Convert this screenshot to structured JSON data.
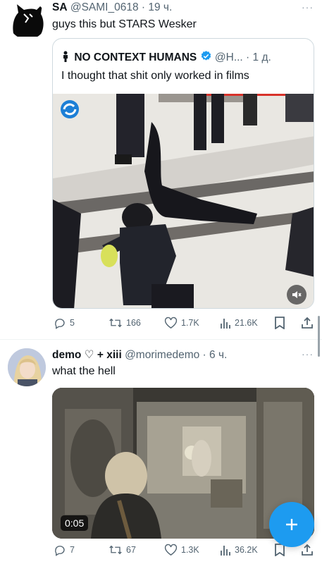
{
  "tweet1": {
    "name": "SA",
    "handle": "@SAMI_0618 · 19 ч.",
    "text": "guys this but STARS Wesker",
    "more": "···",
    "quote": {
      "name": "NO CONTEXT HUMANS",
      "handle": "@H... · 1 д.",
      "text": "I thought that shit only worked in films"
    },
    "actions": {
      "replies": "5",
      "reposts": "166",
      "likes": "1.7K",
      "views": "21.6K"
    }
  },
  "tweet2": {
    "name": "demo ♡ + xiii",
    "handle": "@morimedemo · 6 ч.",
    "text": "what the hell",
    "more": "···",
    "video_duration": "0:05",
    "actions": {
      "replies": "7",
      "reposts": "67",
      "likes": "1.3K",
      "views": "36.2K"
    }
  },
  "colors": {
    "accent": "#1d9bf0",
    "verified": "#1d9bf0",
    "muted_text": "#536471"
  },
  "icons": [
    "reply-icon",
    "repost-icon",
    "like-icon",
    "views-icon",
    "bookmark-icon",
    "share-icon",
    "mute-icon",
    "compose-icon",
    "verified-icon",
    "man-emoji-icon"
  ]
}
